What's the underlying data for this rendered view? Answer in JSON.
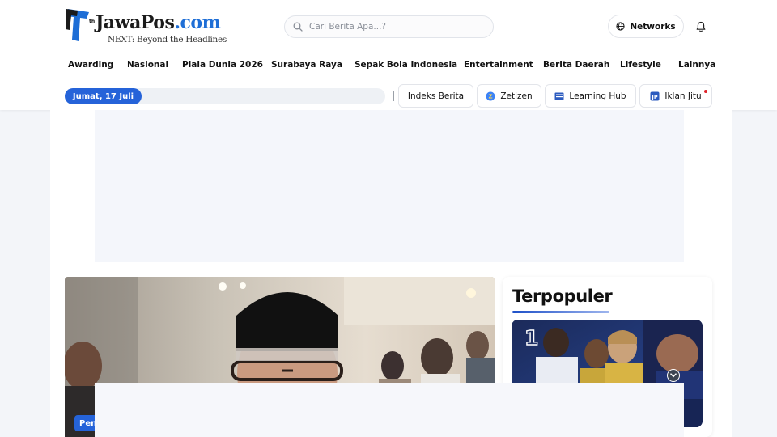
{
  "header": {
    "logo": {
      "brand_main": "JawaPos",
      "brand_suffix": ".com",
      "tagline": "NEXT: Beyond the Headlines",
      "anniversary_suffix": "th",
      "colors": {
        "primary": "#1b1b1b",
        "accent": "#1e6ed6"
      }
    },
    "search": {
      "placeholder": "Cari Berita Apa...?",
      "value": "",
      "icon": "search-icon"
    },
    "networks": {
      "label": "Networks",
      "icon": "globe-icon"
    },
    "notifications": {
      "icon": "bell-icon"
    }
  },
  "nav": {
    "items": [
      {
        "label": "Awarding"
      },
      {
        "label": "Nasional"
      },
      {
        "label": "Piala Dunia 2026"
      },
      {
        "label": "Surabaya Raya"
      },
      {
        "label": "Sepak Bola Indonesia"
      },
      {
        "label": "Entertainment"
      },
      {
        "label": "Berita Daerah"
      },
      {
        "label": "Lifestyle"
      },
      {
        "label": "Lainnya"
      }
    ]
  },
  "subnav": {
    "date": "Jumat, 17 Juli",
    "quick_links": [
      {
        "label": "Indeks Berita"
      },
      {
        "label": "Zetizen",
        "icon": "zetizen-icon"
      },
      {
        "label": "Learning Hub",
        "icon": "learning-hub-icon"
      },
      {
        "label": "Iklan Jitu",
        "icon": "iklan-jitu-icon",
        "notification_dot": true
      }
    ]
  },
  "main": {
    "hero": {
      "category_badge": "Pen"
    },
    "popular": {
      "title": "Terpopuler",
      "top_item": {
        "rank": "1"
      }
    }
  },
  "colors": {
    "brand_blue": "#2563d9",
    "notification_red": "#e0242b",
    "page_bg": "#f3f5f9"
  }
}
